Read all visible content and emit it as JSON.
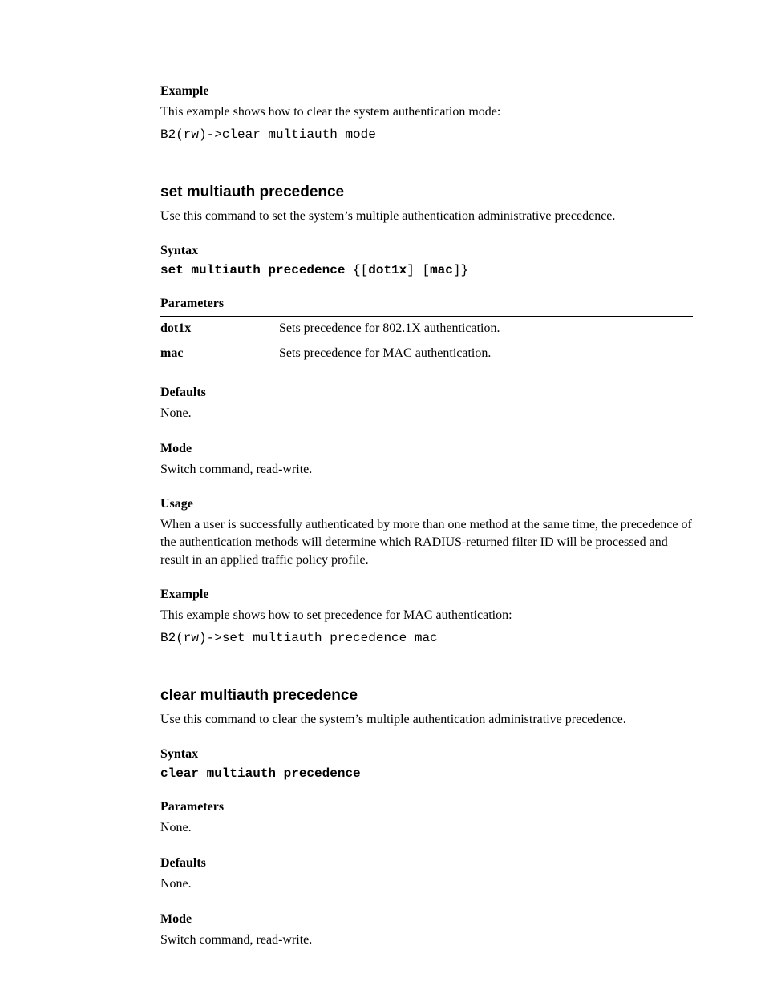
{
  "sec1": {
    "example_label": "Example",
    "example_text": "This example shows how to clear the system authentication mode:",
    "example_code": "B2(rw)->clear multiauth mode"
  },
  "cmd1": {
    "title": "set multiauth precedence",
    "intro": "Use this command to set the system’s multiple authentication administrative precedence.",
    "syntax_label": "Syntax",
    "syntax": "set multiauth precedence {[dot1x] [mac]}",
    "parameters_label": "Parameters",
    "parameters": [
      {
        "name": "dot1x",
        "desc": "Sets precedence for 802.1X authentication."
      },
      {
        "name": "mac",
        "desc": "Sets precedence for MAC authentication."
      }
    ],
    "defaults_label": "Defaults",
    "defaults_text": "None.",
    "mode_label": "Mode",
    "mode_text": "Switch command, read-write.",
    "usage_label": "Usage",
    "usage_text": "When a user is successfully authenticated by more than one method at the same time, the precedence of the authentication methods will determine which RADIUS-returned filter ID will be processed and result in an applied traffic policy profile.",
    "example_label": "Example",
    "example_text": "This example shows how to set precedence for MAC authentication:",
    "example_code": "B2(rw)->set multiauth precedence mac"
  },
  "cmd2": {
    "title": "clear multiauth precedence",
    "intro": "Use this command to clear the system’s multiple authentication administrative precedence.",
    "syntax_label": "Syntax",
    "syntax": "clear multiauth precedence",
    "parameters_label": "Parameters",
    "parameters_text": "None.",
    "defaults_label": "Defaults",
    "defaults_text": "None.",
    "mode_label": "Mode",
    "mode_text": "Switch command, read-write."
  }
}
